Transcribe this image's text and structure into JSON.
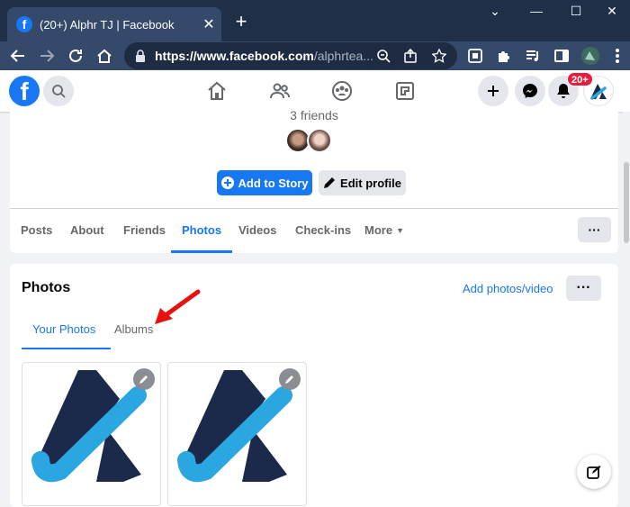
{
  "browser": {
    "tab_title": "(20+) Alphr TJ | Facebook",
    "tab_favicon": "f",
    "tab_close": "✕",
    "new_tab": "+",
    "url_host": "https://www.facebook.com",
    "url_path": "/alphrtea..."
  },
  "fb_header": {
    "logo": "f",
    "notification_badge": "20+"
  },
  "profile": {
    "friends_count": "3 friends",
    "add_story_label": "Add to Story",
    "edit_profile_label": "Edit profile",
    "tabs": [
      {
        "label": "Posts"
      },
      {
        "label": "About"
      },
      {
        "label": "Friends"
      },
      {
        "label": "Photos"
      },
      {
        "label": "Videos"
      },
      {
        "label": "Check-ins"
      },
      {
        "label": "More"
      }
    ],
    "more_dots": "···"
  },
  "photos": {
    "title": "Photos",
    "add_link": "Add photos/video",
    "dots": "···",
    "subtabs": [
      {
        "label": "Your Photos"
      },
      {
        "label": "Albums"
      }
    ]
  },
  "colors": {
    "facebook_blue": "#1877f2",
    "chrome_frame": "#202f48",
    "annotation_arrow": "#e8110e"
  }
}
